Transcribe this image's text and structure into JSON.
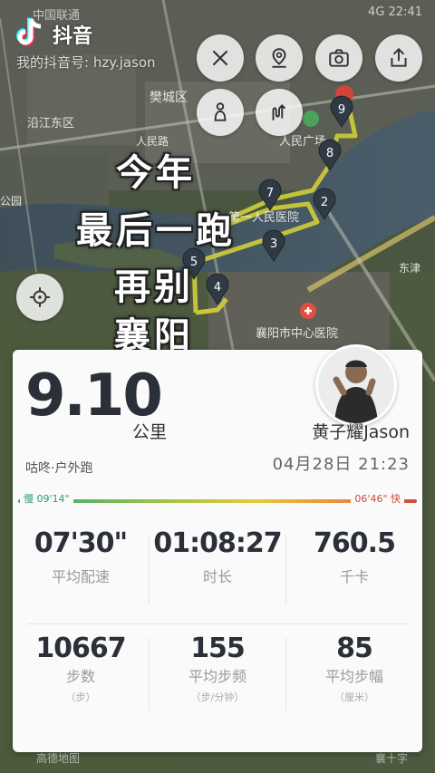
{
  "status_bar": {
    "carrier": "中国联通",
    "right": "4G 22:41"
  },
  "tiktok": {
    "app_name": "抖音",
    "id_text": "我的抖音号: hzy.jason"
  },
  "map_labels": {
    "fancheng": "樊城区",
    "yanbei": "沿江东区",
    "people_square": "人民广场",
    "hospital_first": "第一人民医院",
    "central_hospital": "襄阳市中心医院",
    "renmin_rd": "人民路",
    "park": "公园",
    "dongjin": "东津",
    "bottom_left": "高德地图",
    "bottom_right": "襄十字"
  },
  "markers": [
    "2",
    "3",
    "4",
    "5",
    "7",
    "8",
    "9"
  ],
  "overlay_text": [
    "今年",
    "最后一跑",
    "再别",
    "襄阳"
  ],
  "card": {
    "distance": "9.10",
    "distance_unit": "公里",
    "source": "咕咚·户外跑",
    "username": "黄子耀Jason",
    "datetime": "04月28日 21:23",
    "pace_slow": "慢 09'14\"",
    "pace_fast": "06'46\" 快",
    "stats": [
      {
        "value": "07'30\"",
        "label": "平均配速",
        "sub": ""
      },
      {
        "value": "01:08:27",
        "label": "时长",
        "sub": ""
      },
      {
        "value": "760.5",
        "label": "千卡",
        "sub": ""
      },
      {
        "value": "10667",
        "label": "步数",
        "sub": "（步）"
      },
      {
        "value": "155",
        "label": "平均步频",
        "sub": "（步/分钟）"
      },
      {
        "value": "85",
        "label": "平均步幅",
        "sub": "（厘米）"
      }
    ]
  },
  "colors": {
    "route": "#c9c83a",
    "marker": "#2f3a45",
    "pace_slow": "#2a9d6a",
    "pace_fast": "#d04a3a"
  },
  "icons": [
    "close-icon",
    "location-pin-icon",
    "camera-icon",
    "share-icon",
    "runner-icon",
    "route-toggle-icon",
    "recenter-icon"
  ]
}
